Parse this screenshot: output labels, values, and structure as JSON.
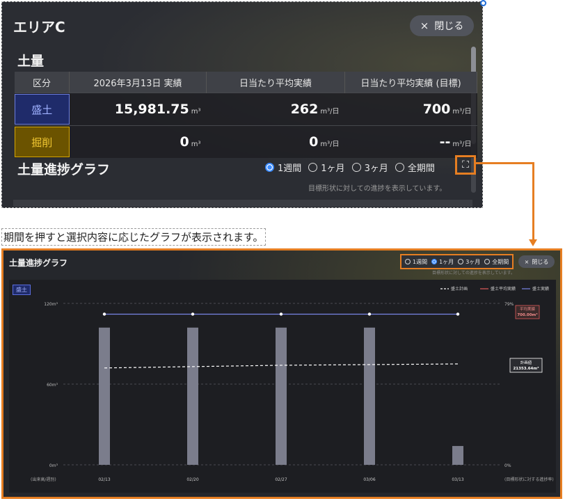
{
  "top_panel": {
    "area_title": "エリアC",
    "close_label": "閉じる",
    "close_icon": "×",
    "soil_title": "土量",
    "table": {
      "headers": [
        "区分",
        "2026年3月13日 実績",
        "日当たり平均実績",
        "日当たり平均実績 (目標)"
      ],
      "rows": [
        {
          "category": "盛土",
          "actual": "15,981.75",
          "actual_unit": "m³",
          "daily_avg": "262",
          "daily_avg_unit": "m³/日",
          "daily_target": "700",
          "daily_target_unit": "m³/日"
        },
        {
          "category": "掘削",
          "actual": "0",
          "actual_unit": "m³",
          "daily_avg": "0",
          "daily_avg_unit": "m³/日",
          "daily_target": "--",
          "daily_target_unit": "m³/日"
        }
      ]
    },
    "progress_title": "土量進捗グラフ",
    "periods": [
      "1週間",
      "1ヶ月",
      "3ヶ月",
      "全期間"
    ],
    "selected_period": "1週間",
    "expand_icon": "⛶",
    "progress_note": "目標形状に対しての進捗を表示しています。"
  },
  "caption": "期間を押すと選択内容に応じたグラフが表示されます。",
  "bottom_panel": {
    "title": "土量進捗グラフ",
    "periods": [
      "1週間",
      "1ヶ月",
      "3ヶ月",
      "全期間"
    ],
    "selected_period": "1ヶ月",
    "close_label": "閉じる",
    "close_icon": "×",
    "note": "目標形状に対しての進捗を表示しています。",
    "series_badge": "盛土"
  },
  "colors": {
    "accent_orange": "#e67e22",
    "radio_selected": "#3d8cff",
    "mori_fill": "#1f2b6a",
    "kussaku_fill": "#6b5300",
    "bar": "#7b7d8c",
    "plan_line": "#ffffff",
    "avg_line": "#e05a5a",
    "actual_line": "#7a86e8"
  },
  "chart_data": {
    "type": "bar",
    "categories": [
      "02/13",
      "02/20",
      "02/27",
      "03/06",
      "03/13"
    ],
    "series": [
      {
        "name": "盛土実績",
        "kind": "line",
        "values": [
          112,
          112,
          112,
          112,
          112
        ]
      },
      {
        "name": "盛土計画",
        "kind": "dashed-line",
        "values": [
          72,
          73,
          74,
          74.5,
          75
        ]
      },
      {
        "name": "盛土平均実績",
        "kind": "line",
        "values": []
      },
      {
        "name": "bars",
        "kind": "bar",
        "values": [
          102,
          102,
          102,
          102,
          14
        ]
      }
    ],
    "legend": [
      "盛土計画",
      "盛土平均実績",
      "盛土実績"
    ],
    "legend_position": "top-right",
    "y_ticks": [
      "0m³",
      "60m³",
      "120m³"
    ],
    "ylim": [
      0,
      120
    ],
    "right_ticks": [
      "0%",
      "79%"
    ],
    "xlabel_left": "(出来高/週別)",
    "xlabel_right": "(目標形状に対する進捗率)",
    "annotations": [
      {
        "label": "平均実績",
        "value": "700.00m³"
      },
      {
        "label": "計画値",
        "value": "21353.64m³"
      }
    ],
    "grid": true
  }
}
